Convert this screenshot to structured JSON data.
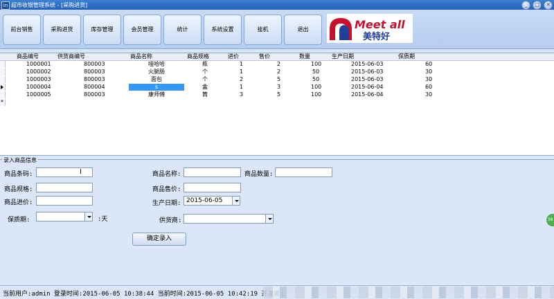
{
  "window": {
    "title": "超市收银管理系统 - [采购进货]",
    "icon": "app-icon",
    "controls": [
      "_",
      "□",
      "✕"
    ]
  },
  "toolbar": {
    "buttons": [
      "前台销售",
      "采购进货",
      "库存管理",
      "会员管理",
      "统计",
      "系统设置",
      "挂机",
      "退出"
    ]
  },
  "logo": {
    "text_en": "Meet all",
    "text_cn": "美特好",
    "colors": [
      "#c8102e",
      "#1f3f9a"
    ]
  },
  "grid": {
    "columns": [
      "商品编号",
      "供货商编号",
      "商品名称",
      "商品规格",
      "进价",
      "售价",
      "数量",
      "生产日期",
      "保质期"
    ],
    "rows": [
      [
        "1000001",
        "800003",
        "哇哈哈",
        "瓶",
        "1",
        "2",
        "100",
        "2015-06-03",
        "60"
      ],
      [
        "1000002",
        "800003",
        "火腿肠",
        "个",
        "1",
        "2",
        "50",
        "2015-06-03",
        "30"
      ],
      [
        "1000003",
        "800003",
        "面包",
        "个",
        "2",
        "5",
        "50",
        "2015-06-03",
        "30"
      ],
      [
        "1000004",
        "800004",
        "s",
        "盒",
        "1",
        "3",
        "100",
        "2015-06-04",
        "60"
      ],
      [
        "1000005",
        "800003",
        "康师傅",
        "筒",
        "3",
        "5",
        "100",
        "2015-06-04",
        "30"
      ]
    ],
    "new_row_marker": "*"
  },
  "form": {
    "legend": "录入商品信息",
    "barcode_label": "商品条码:",
    "barcode_value": "",
    "name_label": "商品名称:",
    "name_value": "",
    "qty_label": "商品数量:",
    "qty_value": "",
    "spec_label": "商品规格:",
    "spec_value": "",
    "sale_price_label": "商品售价:",
    "sale_price_value": "",
    "cost_label": "商品进价:",
    "cost_value": "",
    "date_label": "生产日期:",
    "date_value": "2015-06-05",
    "shelf_label": "保质期:",
    "shelf_value": "",
    "shelf_unit": ":天",
    "supplier_label": "供货商:",
    "supplier_value": "",
    "submit_label": "确定录入"
  },
  "status": {
    "text": "当前用户:admin 登录时间:2015-06-05 10:38:44 当前时间:2015-06-05 10:42:19 开发者:"
  },
  "side_bubble": "38"
}
